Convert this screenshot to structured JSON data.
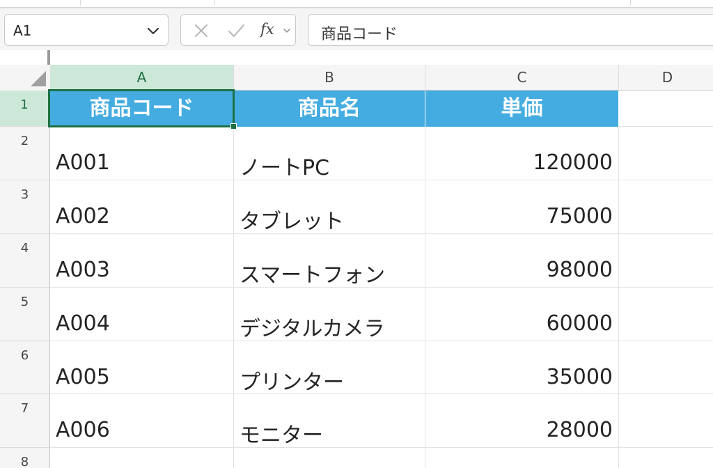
{
  "name_box": {
    "value": "A1"
  },
  "formula_bar": {
    "value": "商品コード"
  },
  "function_box": {
    "fx_label": "fx"
  },
  "columns": [
    "A",
    "B",
    "C",
    "D"
  ],
  "rows": [
    "1",
    "2",
    "3",
    "4",
    "5",
    "6",
    "7",
    "8"
  ],
  "table": {
    "headers": [
      "商品コード",
      "商品名",
      "単価"
    ],
    "rows": [
      [
        "A001",
        "ノートPC",
        "120000"
      ],
      [
        "A002",
        "タブレット",
        "75000"
      ],
      [
        "A003",
        "スマートフォン",
        "98000"
      ],
      [
        "A004",
        "デジタルカメラ",
        "60000"
      ],
      [
        "A005",
        "プリンター",
        "35000"
      ],
      [
        "A006",
        "モニター",
        "28000"
      ]
    ]
  },
  "icons": {
    "name_box_dropdown": "chevron-down-icon",
    "cancel": "x-icon",
    "confirm": "check-icon",
    "insert_function": "fx-icon",
    "select_all": "select-all-triangle-icon"
  },
  "colors": {
    "header_fill": "#44ace0",
    "header_text": "#ffffff",
    "selection": "#1e7145",
    "selected_header_bg": "#cde8d9"
  }
}
